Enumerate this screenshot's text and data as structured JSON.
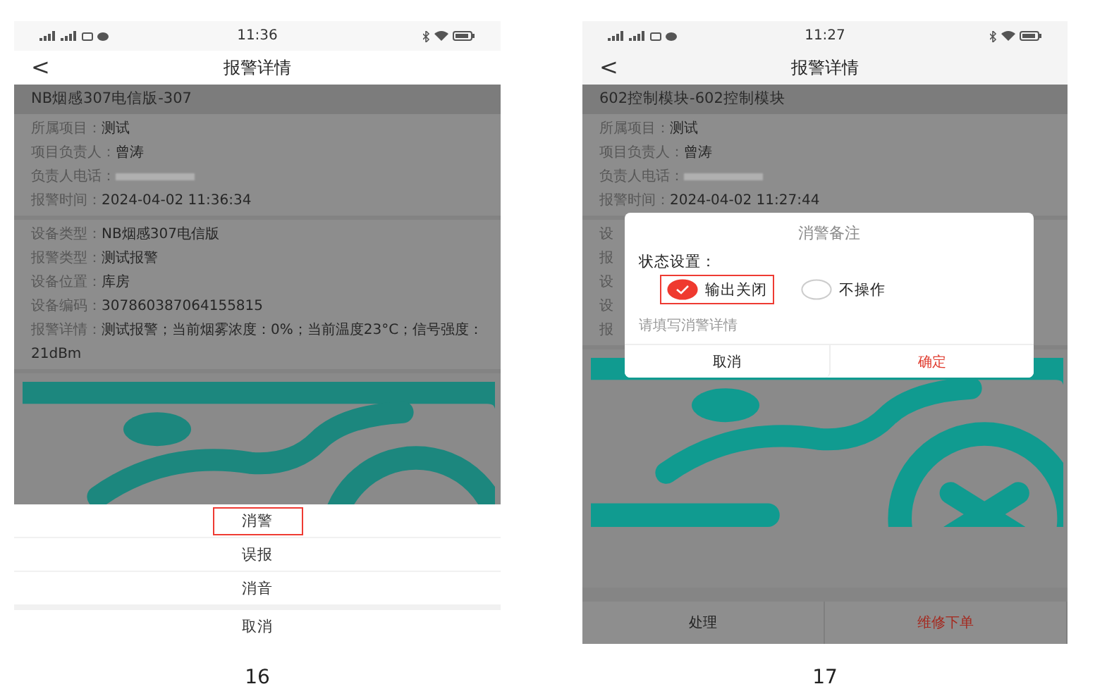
{
  "figures": [
    {
      "caption": "16",
      "status_bar": {
        "time": "11:36"
      },
      "header": {
        "back": "<",
        "title": "报警详情"
      },
      "device_title": "NB烟感307电信版-307",
      "sections": [
        [
          {
            "label": "所属项目：",
            "value": "测试"
          },
          {
            "label": "项目负责人：",
            "value": "曾涛"
          },
          {
            "label": "负责人电话：",
            "masked": true
          },
          {
            "label": "报警时间：",
            "value": "2024-04-02 11:36:34"
          }
        ],
        [
          {
            "label": "设备类型：",
            "value": "NB烟感307电信版"
          },
          {
            "label": "报警类型：",
            "value": "测试报警"
          },
          {
            "label": "设备位置：",
            "value": "库房"
          },
          {
            "label": "设备编码：",
            "value": "307860387064155815"
          },
          {
            "label": "报警详情：",
            "value": "测试报警；当前烟雾浓度：0%；当前温度23°C；信号强度：21dBm"
          }
        ]
      ],
      "action_sheet": {
        "items": [
          {
            "label": "消警",
            "highlighted": true
          },
          {
            "label": "误报",
            "highlighted": false
          },
          {
            "label": "消音",
            "highlighted": false
          }
        ],
        "cancel": "取消"
      }
    },
    {
      "caption": "17",
      "status_bar": {
        "time": "11:27"
      },
      "header": {
        "back": "<",
        "title": "报警详情"
      },
      "device_title": "602控制模块-602控制模块",
      "sections": [
        [
          {
            "label": "所属项目：",
            "value": "测试"
          },
          {
            "label": "项目负责人：",
            "value": "曾涛"
          },
          {
            "label": "负责人电话：",
            "masked": true
          },
          {
            "label": "报警时间：",
            "value": "2024-04-02 11:27:44"
          }
        ],
        [
          {
            "label": "设"
          },
          {
            "label": "报"
          },
          {
            "label": "设"
          },
          {
            "label": "设"
          },
          {
            "label": "报"
          }
        ]
      ],
      "dialog": {
        "title": "消警备注",
        "status_label": "状态设置：",
        "options": [
          {
            "label": "输出关闭",
            "selected": true,
            "highlighted": true
          },
          {
            "label": "不操作",
            "selected": false,
            "highlighted": false
          }
        ],
        "placeholder": "请填写消警详情",
        "buttons": [
          {
            "label": "取消",
            "kind": "cancel"
          },
          {
            "label": "确定",
            "kind": "confirm"
          }
        ]
      },
      "bottom_buttons": [
        {
          "label": "处理",
          "kind": "normal"
        },
        {
          "label": "维修下单",
          "kind": "danger"
        }
      ]
    }
  ]
}
